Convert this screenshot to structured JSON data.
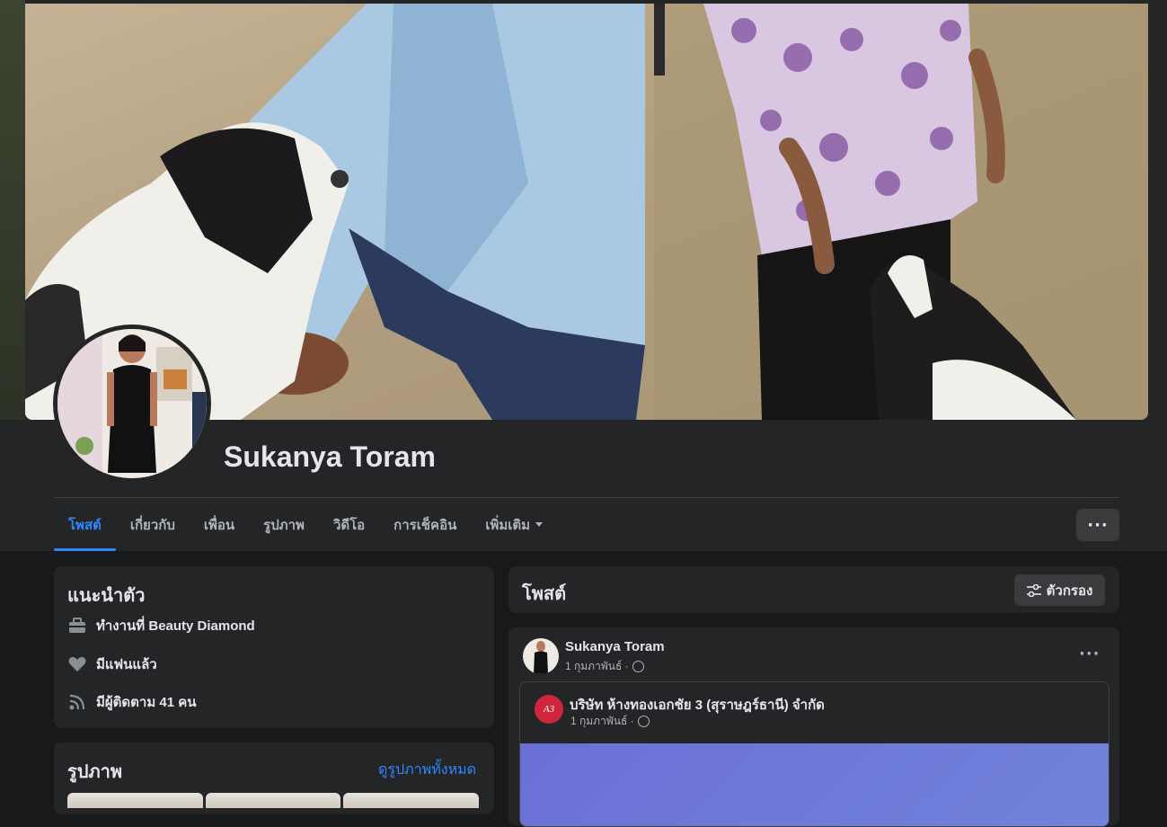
{
  "profile": {
    "name": "Sukanya Toram"
  },
  "tabs": [
    {
      "label": "โพสต์",
      "active": true
    },
    {
      "label": "เกี่ยวกับ"
    },
    {
      "label": "เพื่อน"
    },
    {
      "label": "รูปภาพ"
    },
    {
      "label": "วิดีโอ"
    },
    {
      "label": "การเช็คอิน"
    },
    {
      "label": "เพิ่มเติม"
    }
  ],
  "more_button": "···",
  "intro": {
    "title": "แนะนำตัว",
    "items": [
      {
        "icon": "briefcase-icon",
        "text": "ทำงานที่ Beauty Diamond"
      },
      {
        "icon": "heart-icon",
        "text": "มีแฟนแล้ว"
      },
      {
        "icon": "rss-icon",
        "text": "มีผู้ติดตาม 41 คน"
      }
    ]
  },
  "photos": {
    "title": "รูปภาพ",
    "see_all": "ดูรูปภาพทั้งหมด"
  },
  "posts": {
    "title": "โพสต์",
    "filter_label": "ตัวกรอง",
    "post": {
      "author": "Sukanya Toram",
      "date": "1 กุมภาพันธ์ ·",
      "shared": {
        "author": "บริษัท ห้างทองเอกชัย 3 (สุราษฎร์ธานี) จำกัด",
        "date": "1 กุมภาพันธ์ ·",
        "logo_text": "A3"
      }
    }
  },
  "colors": {
    "accent": "#2d88ff",
    "background": "#18191a",
    "card": "#242526"
  }
}
